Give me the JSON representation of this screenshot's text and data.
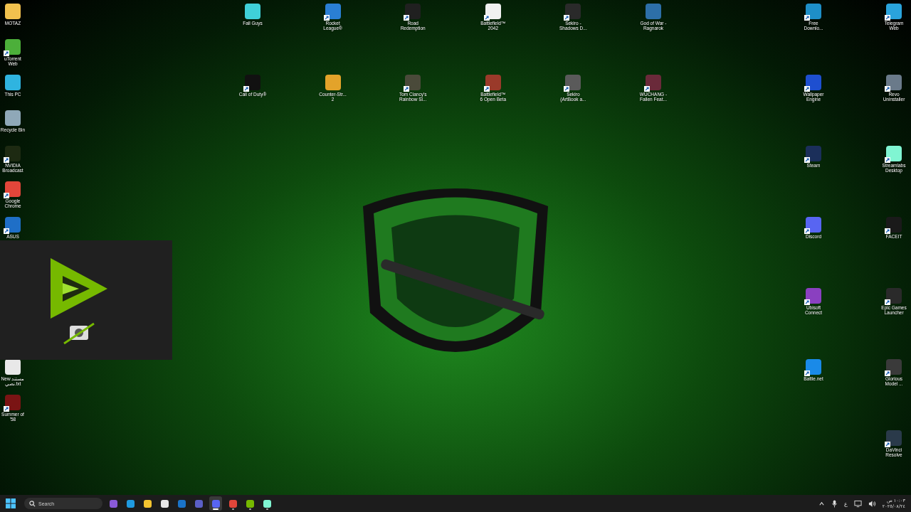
{
  "desktop": {
    "left_column_top": [
      {
        "label": "MOTAZ",
        "color": "#f2c14e",
        "shortcut": false
      },
      {
        "label": "uTorrent Web",
        "color": "#4caf3a",
        "shortcut": true
      },
      {
        "label": "This PC",
        "color": "#2fb4e0",
        "shortcut": false
      },
      {
        "label": "Recycle Bin",
        "color": "#8fa8b8",
        "shortcut": false
      },
      {
        "label": "NVIDIA Broadcast",
        "color": "#1d2a12",
        "shortcut": true
      },
      {
        "label": "Google Chrome",
        "color": "#e2463a",
        "shortcut": true
      },
      {
        "label": "ASUS",
        "color": "#1f6fc7",
        "shortcut": true
      }
    ],
    "left_column_bottom": [
      {
        "label": "New مستند نصي.txt",
        "color": "#e8e8e8",
        "shortcut": false
      },
      {
        "label": "Summer of '58",
        "color": "#7a1414",
        "shortcut": true
      }
    ],
    "top_rows": [
      {
        "label": "Fall Guys",
        "color": "#3fd0d8",
        "shortcut": false
      },
      {
        "label": "Rocket League®",
        "color": "#2a7fd4",
        "shortcut": true
      },
      {
        "label": "Road Redemption",
        "color": "#202020",
        "shortcut": true
      },
      {
        "label": "Battlefield™ 2042",
        "color": "#f0f0f0",
        "shortcut": true
      },
      {
        "label": "Sekiro - Shadows D...",
        "color": "#2a2a2a",
        "shortcut": true
      },
      {
        "label": "God of War - Ragnarok",
        "color": "#2d6fa8",
        "shortcut": false
      },
      {
        "label": "Call of Duty®",
        "color": "#111111",
        "shortcut": true
      },
      {
        "label": "Counter-Str... 2",
        "color": "#e3a32a",
        "shortcut": false
      },
      {
        "label": "Tom Clancy's Rainbow Si...",
        "color": "#4a4a3a",
        "shortcut": true
      },
      {
        "label": "Battlefield™ 6 Open Beta",
        "color": "#9a3a2a",
        "shortcut": true
      },
      {
        "label": "Sekiro (ArtBook a...",
        "color": "#5a5a5a",
        "shortcut": true
      },
      {
        "label": "WUCHANG - Fallen Feat...",
        "color": "#6a2a3a",
        "shortcut": true
      }
    ],
    "right_columns": [
      [
        {
          "label": "Free Downlo...",
          "color": "#1e8fc8",
          "shortcut": true
        },
        {
          "label": "Wallpaper Engine",
          "color": "#1e4fd0",
          "shortcut": true
        },
        {
          "label": "Steam",
          "color": "#1b2f5a",
          "shortcut": true
        },
        {
          "label": "Discord",
          "color": "#5865f2",
          "shortcut": true
        },
        {
          "label": "Ubisoft Connect",
          "color": "#8a40c0",
          "shortcut": true
        },
        {
          "label": "Battle.net",
          "color": "#1a8ae8",
          "shortcut": true
        }
      ],
      [
        {
          "label": "Telegram Web",
          "color": "#2aa3dc",
          "shortcut": true
        },
        {
          "label": "Revo Uninstaller",
          "color": "#6a7a8a",
          "shortcut": true
        },
        {
          "label": "Streamlabs Desktop",
          "color": "#80f5d2",
          "shortcut": true
        },
        {
          "label": "FACEIT",
          "color": "#1a1a1a",
          "shortcut": true
        },
        {
          "label": "Epic Games Launcher",
          "color": "#2a2a2a",
          "shortcut": true
        },
        {
          "label": "Glorious Model ...",
          "color": "#3a3a3a",
          "shortcut": true
        },
        {
          "label": "DaVinci Resolve",
          "color": "#2a3a4a",
          "shortcut": true
        }
      ]
    ]
  },
  "taskbar": {
    "search": {
      "placeholder": "Search"
    },
    "apps": [
      {
        "color": "#8a5ad8",
        "running": false,
        "active": false
      },
      {
        "color": "#1f9ae0",
        "running": false,
        "active": false
      },
      {
        "color": "#f4c430",
        "running": false,
        "active": false
      },
      {
        "color": "#e8e8e8",
        "running": false,
        "active": false
      },
      {
        "color": "#1a73c8",
        "running": false,
        "active": false
      },
      {
        "color": "#5b5fc7",
        "running": false,
        "active": false
      },
      {
        "color": "#5865f2",
        "running": true,
        "active": true
      },
      {
        "color": "#e2463a",
        "running": true,
        "active": false
      },
      {
        "color": "#76b900",
        "running": true,
        "active": false
      },
      {
        "color": "#80f5d2",
        "running": true,
        "active": false
      }
    ],
    "keyboard_language": "ع",
    "time": "١٠:٠٣ ص",
    "date": "٢٠٢٥/٠٨/٢٤"
  }
}
